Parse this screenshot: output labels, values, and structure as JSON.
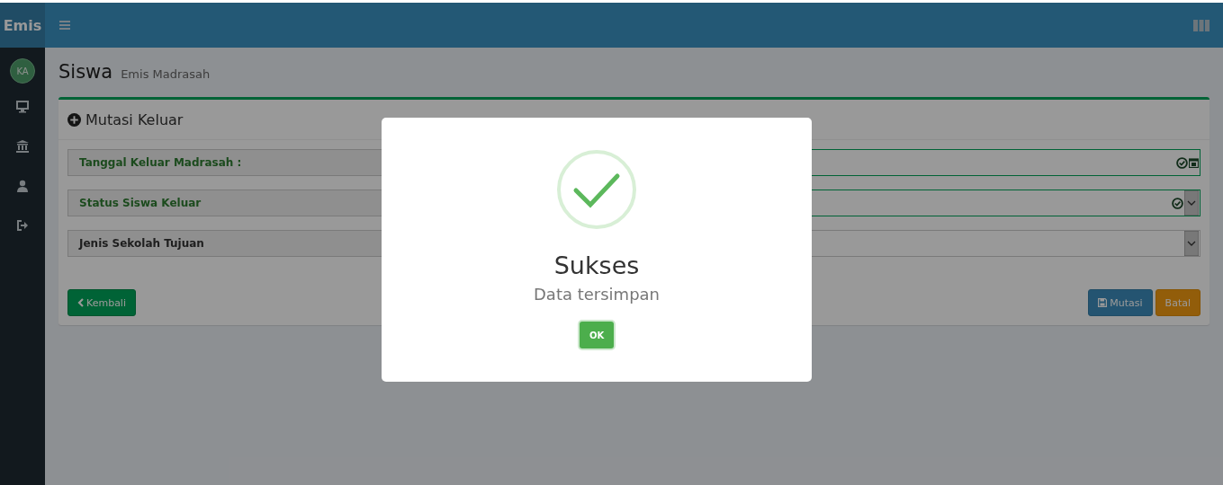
{
  "header": {
    "brand": "Emis"
  },
  "sidebar": {
    "avatar_initials": "KA",
    "items": [
      {
        "kind": "monitor"
      },
      {
        "kind": "bank"
      },
      {
        "kind": "user"
      },
      {
        "kind": "logout"
      }
    ]
  },
  "page": {
    "title": "Siswa",
    "subtitle": "Emis Madrasah"
  },
  "form": {
    "title": "Mutasi Keluar",
    "fields": [
      {
        "label": "Tanggal Keluar Madrasah :",
        "kind": "date",
        "valid": true
      },
      {
        "label": "Status Siswa Keluar",
        "kind": "select",
        "valid": true
      },
      {
        "label": "Jenis Sekolah Tujuan",
        "kind": "select",
        "valid": false
      }
    ],
    "back_button": "Kembali",
    "save_button": "Mutasi",
    "cancel_button": "Batal"
  },
  "modal": {
    "title": "Sukses",
    "text": "Data tersimpan",
    "ok_button": "OK"
  }
}
